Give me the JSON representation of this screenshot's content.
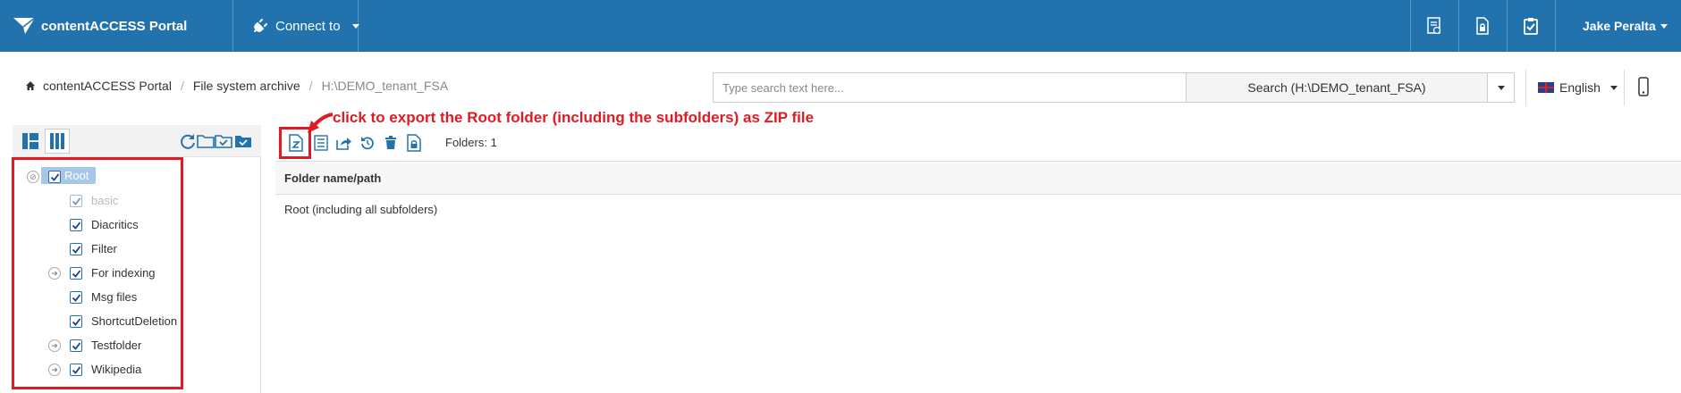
{
  "colors": {
    "navbar": "#2273ad",
    "accent": "#2273ad",
    "annotation": "#e01b24",
    "selection": "#a7c7e7"
  },
  "navbar": {
    "brand": "contentACCESS Portal",
    "connect_label": "Connect to",
    "icons": [
      "report-icon",
      "lock-document-icon",
      "clipboard-check-icon"
    ],
    "user_name": "Jake Peralta"
  },
  "breadcrumb": {
    "items": [
      "contentACCESS Portal",
      "File system archive"
    ],
    "current": "H:\\DEMO_tenant_FSA"
  },
  "search": {
    "placeholder": "Type search text here...",
    "button_label": "Search (H:\\DEMO_tenant_FSA)"
  },
  "language": {
    "selected": "English"
  },
  "left_panel": {
    "view_icons": [
      "tree-view-icon",
      "columns-view-icon"
    ],
    "tools": [
      "refresh-icon",
      "folder-icon",
      "folder-check-icon",
      "folder-checked-all-icon"
    ],
    "tree": {
      "root": {
        "label": "Root",
        "checked": true,
        "selected": true
      },
      "children": [
        {
          "label": "basic",
          "checked": true,
          "disabled": true,
          "expandable": false
        },
        {
          "label": "Diacritics",
          "checked": true,
          "expandable": false
        },
        {
          "label": "Filter",
          "checked": true,
          "expandable": false
        },
        {
          "label": "For indexing",
          "checked": true,
          "expandable": true
        },
        {
          "label": "Msg files",
          "checked": true,
          "expandable": false
        },
        {
          "label": "ShortcutDeletion",
          "checked": true,
          "expandable": false
        },
        {
          "label": "Testfolder",
          "checked": true,
          "expandable": true
        },
        {
          "label": "Wikipedia",
          "checked": true,
          "expandable": true
        }
      ]
    }
  },
  "toolbar": {
    "buttons": [
      "export-zip-icon",
      "list-icon",
      "share-icon",
      "restore-icon",
      "delete-icon",
      "lock-file-icon"
    ],
    "folders_count": "Folders: 1"
  },
  "annotation": "click to export the Root folder (including the subfolders) as ZIP file",
  "grid": {
    "columns": [
      "Folder name/path"
    ],
    "rows": [
      [
        "Root (including all subfolders)"
      ]
    ]
  }
}
